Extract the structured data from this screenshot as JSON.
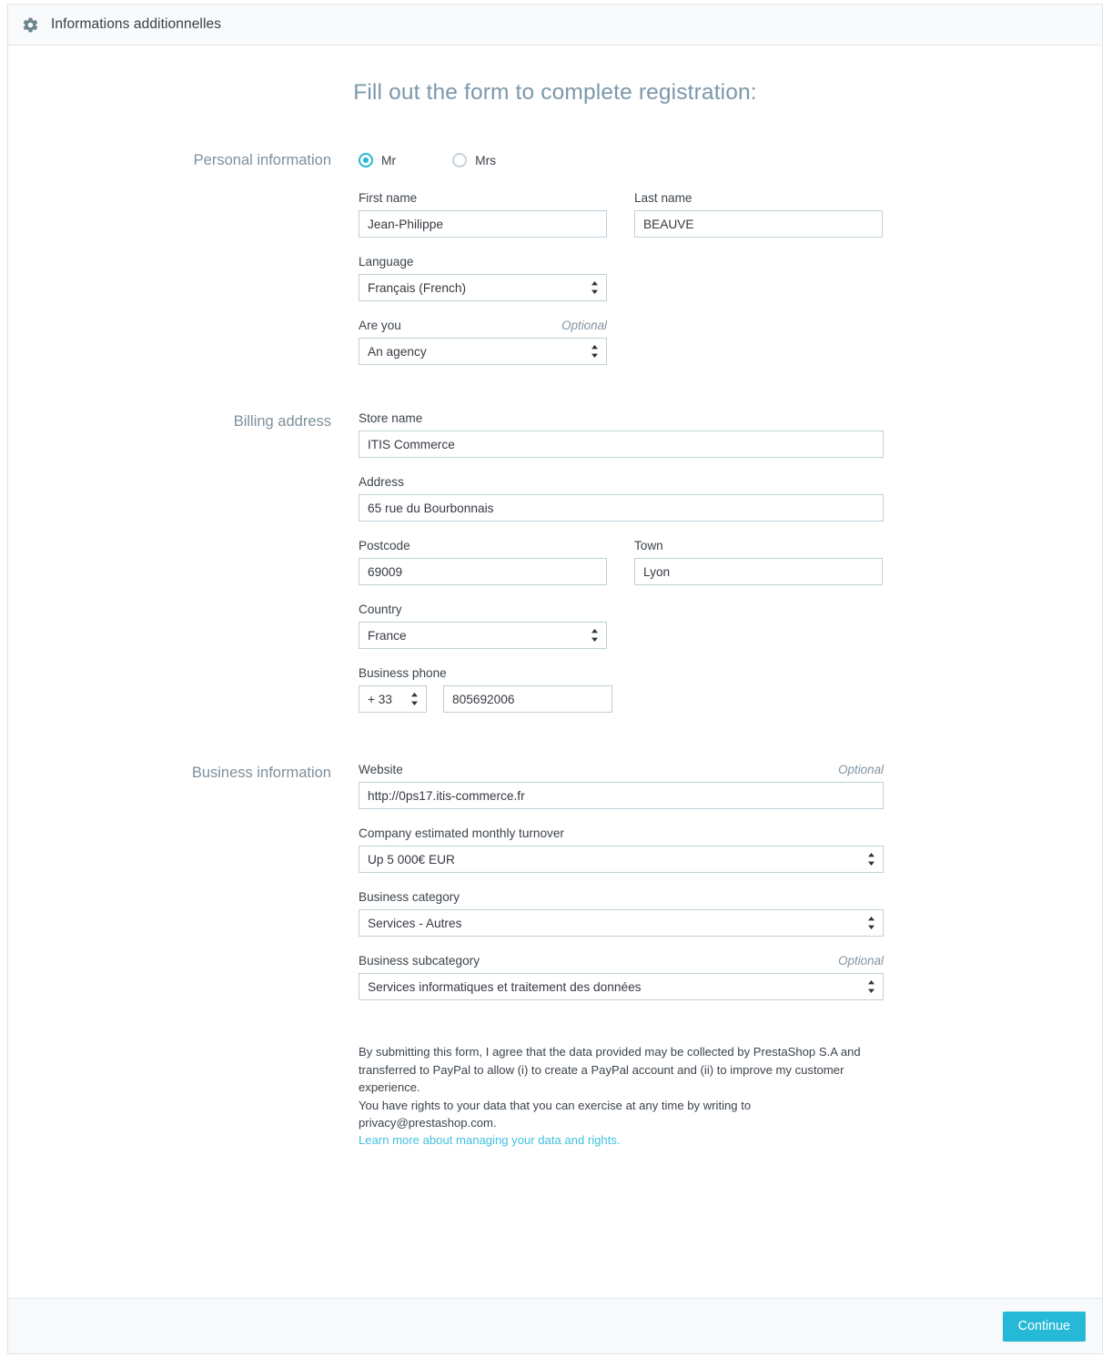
{
  "header": {
    "icon": "gear-icon",
    "title": "Informations additionnelles"
  },
  "form": {
    "title": "Fill out the form to complete registration:",
    "sections": {
      "personal": {
        "label": "Personal information",
        "gender": {
          "options": [
            {
              "label": "Mr",
              "selected": true
            },
            {
              "label": "Mrs",
              "selected": false
            }
          ]
        },
        "first_name": {
          "label": "First name",
          "value": "Jean-Philippe"
        },
        "last_name": {
          "label": "Last name",
          "value": "BEAUVE"
        },
        "language": {
          "label": "Language",
          "value": "Français (French)"
        },
        "are_you": {
          "label": "Are you",
          "optional": "Optional",
          "value": "An agency"
        }
      },
      "billing": {
        "label": "Billing address",
        "store_name": {
          "label": "Store name",
          "value": "ITIS Commerce"
        },
        "address": {
          "label": "Address",
          "value": "65 rue du Bourbonnais"
        },
        "postcode": {
          "label": "Postcode",
          "value": "69009"
        },
        "town": {
          "label": "Town",
          "value": "Lyon"
        },
        "country": {
          "label": "Country",
          "value": "France"
        },
        "phone": {
          "label": "Business phone",
          "prefix": "+ 33",
          "number": "805692006"
        }
      },
      "business": {
        "label": "Business information",
        "website": {
          "label": "Website",
          "optional": "Optional",
          "value": "http://0ps17.itis-commerce.fr"
        },
        "turnover": {
          "label": "Company estimated monthly turnover",
          "value": "Up 5 000€ EUR"
        },
        "category": {
          "label": "Business category",
          "value": "Services - Autres"
        },
        "subcategory": {
          "label": "Business subcategory",
          "optional": "Optional",
          "value": "Services informatiques et traitement des données"
        }
      }
    },
    "legal": {
      "paragraph1": "By submitting this form, I agree that the data provided may be collected by PrestaShop S.A and transferred to PayPal to allow (i) to create a PayPal account and (ii) to improve my customer experience.",
      "paragraph2": "You have rights to your data that you can exercise at any time by writing to privacy@prestashop.com.",
      "link": "Learn more about managing your data and rights."
    }
  },
  "footer": {
    "continue_label": "Continue"
  },
  "colors": {
    "accent": "#25b9d7",
    "link": "#3fc1e0",
    "section_label": "#7f909c",
    "title": "#7b98ab",
    "field_border": "#bfd0d8"
  }
}
